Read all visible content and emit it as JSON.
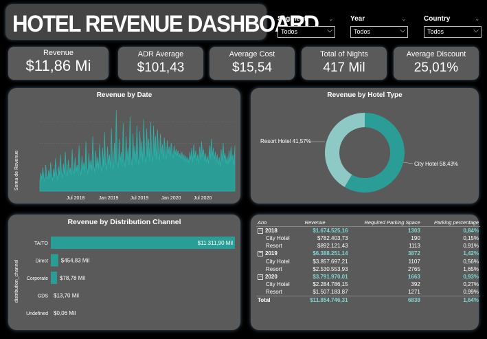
{
  "title": "HOTEL REVENUE DASHBOARD",
  "slicers": [
    {
      "label": "Segment",
      "value": "Todos"
    },
    {
      "label": "Year",
      "value": "Todos"
    },
    {
      "label": "Country",
      "value": "Todos"
    }
  ],
  "kpis": [
    {
      "label": "Revenue",
      "value": "$11,86 Mi"
    },
    {
      "label": "ADR Average",
      "value": "$101,43"
    },
    {
      "label": "Average Cost",
      "value": "$15,54"
    },
    {
      "label": "Total of Nights",
      "value": "417 Mil"
    },
    {
      "label": "Average Discount",
      "value": "25,01%"
    }
  ],
  "revenue_by_date": {
    "title": "Revenue by Date",
    "ylabel": "Soma de Revenue",
    "xticks": [
      "Jul 2018",
      "Jan 2019",
      "Jul 2019",
      "Jan 2020",
      "Jul 2020"
    ]
  },
  "hotel_type": {
    "title": "Revenue by Hotel Type",
    "resort_label": "Resort Hotel 41,57%",
    "city_label": "City Hotel 58,43%"
  },
  "distribution": {
    "title": "Revenue by Distribution Channel",
    "ylabel": "distribution_channel"
  },
  "table": {
    "headers": [
      "Ano",
      "Revenue",
      "Required Parking Space",
      "Parking percentage"
    ],
    "rows": [
      {
        "type": "year",
        "name": "2018",
        "revenue": "$1.674.525,16",
        "parking": "1303",
        "pct": "0,84%"
      },
      {
        "type": "sub",
        "name": "City Hotel",
        "revenue": "$782.403,73",
        "parking": "190",
        "pct": "0,15%"
      },
      {
        "type": "sub",
        "name": "Resort",
        "revenue": "$892.121,43",
        "parking": "1113",
        "pct": "0,91%"
      },
      {
        "type": "year",
        "name": "2019",
        "revenue": "$6.388.251,14",
        "parking": "3872",
        "pct": "1,42%"
      },
      {
        "type": "sub",
        "name": "City Hotel",
        "revenue": "$3.857.697,21",
        "parking": "1107",
        "pct": "0,56%"
      },
      {
        "type": "sub",
        "name": "Resort",
        "revenue": "$2.530.553,93",
        "parking": "2765",
        "pct": "1,65%"
      },
      {
        "type": "year",
        "name": "2020",
        "revenue": "$3.791.970,01",
        "parking": "1663",
        "pct": "0,93%"
      },
      {
        "type": "sub",
        "name": "City Hotel",
        "revenue": "$2.284.786,15",
        "parking": "392",
        "pct": "0,27%"
      },
      {
        "type": "sub",
        "name": "Resort",
        "revenue": "$1.507.183,87",
        "parking": "1271",
        "pct": "0,99%"
      }
    ],
    "total": {
      "name": "Total",
      "revenue": "$11.854.746,31",
      "parking": "6838",
      "pct": "1,64%"
    }
  },
  "colors": {
    "teal": "#2a9d96",
    "teal_light": "#8fc9c5",
    "panel": "#5a5a5a"
  },
  "chart_data": [
    {
      "type": "bar",
      "title": "Revenue by Distribution Channel",
      "ylabel": "distribution_channel",
      "categories": [
        "TA/TO",
        "Direct",
        "Corporate",
        "GDS",
        "Undefined"
      ],
      "values": [
        11311.9,
        454.83,
        78.78,
        13.7,
        0.06
      ],
      "value_labels": [
        "$11.311,90 Mil",
        "$454,83 Mil",
        "$78,78 Mil",
        "$13,70 Mil",
        "$0,06 Mil"
      ]
    },
    {
      "type": "pie",
      "title": "Revenue by Hotel Type",
      "categories": [
        "City Hotel",
        "Resort Hotel"
      ],
      "values": [
        58.43,
        41.57
      ]
    },
    {
      "type": "area",
      "title": "Revenue by Date",
      "ylabel": "Soma de Revenue",
      "xticks": [
        "Jul 2018",
        "Jan 2019",
        "Jul 2019",
        "Jan 2020",
        "Jul 2020"
      ],
      "values": [
        8,
        14,
        9,
        18,
        11,
        7,
        20,
        12,
        9,
        16,
        10,
        22,
        13,
        8,
        17,
        11,
        25,
        14,
        9,
        19,
        12,
        28,
        15,
        10,
        21,
        13,
        30,
        16,
        11,
        24,
        14,
        18,
        12,
        32,
        17,
        13,
        26,
        15,
        20,
        14,
        35,
        18,
        12,
        27,
        16,
        22,
        15,
        38,
        19,
        13,
        29,
        17,
        24,
        16,
        42,
        20,
        14,
        31,
        18,
        26,
        17,
        36,
        21,
        15,
        33,
        19,
        45,
        22,
        16,
        34,
        20,
        28,
        18,
        48,
        23,
        17,
        37,
        21,
        62,
        24,
        18,
        40,
        22,
        30,
        19,
        52,
        25,
        18,
        42,
        23,
        33,
        20,
        57,
        26,
        19,
        44,
        24,
        35,
        21,
        50,
        27,
        20,
        46,
        25,
        38,
        22,
        55,
        28,
        21,
        48,
        26,
        40,
        23,
        53,
        29,
        22,
        50,
        27,
        42,
        24,
        47,
        30,
        23,
        44,
        28,
        36,
        25,
        41,
        31,
        24,
        39,
        29,
        34,
        26,
        37,
        30,
        25,
        35,
        28,
        32,
        27,
        31,
        26,
        29,
        25,
        30,
        24,
        28,
        23,
        27,
        22,
        26,
        21,
        30,
        24,
        33,
        22,
        36,
        25,
        31,
        23,
        28,
        21,
        34,
        24,
        38,
        26,
        32,
        23,
        29,
        22,
        27,
        21,
        35,
        25,
        40,
        27,
        33,
        24,
        30,
        22,
        28,
        20,
        26,
        19,
        32,
        23,
        37,
        25,
        29,
        21,
        27,
        20,
        31,
        22,
        34,
        24,
        28,
        20,
        35
      ]
    }
  ]
}
